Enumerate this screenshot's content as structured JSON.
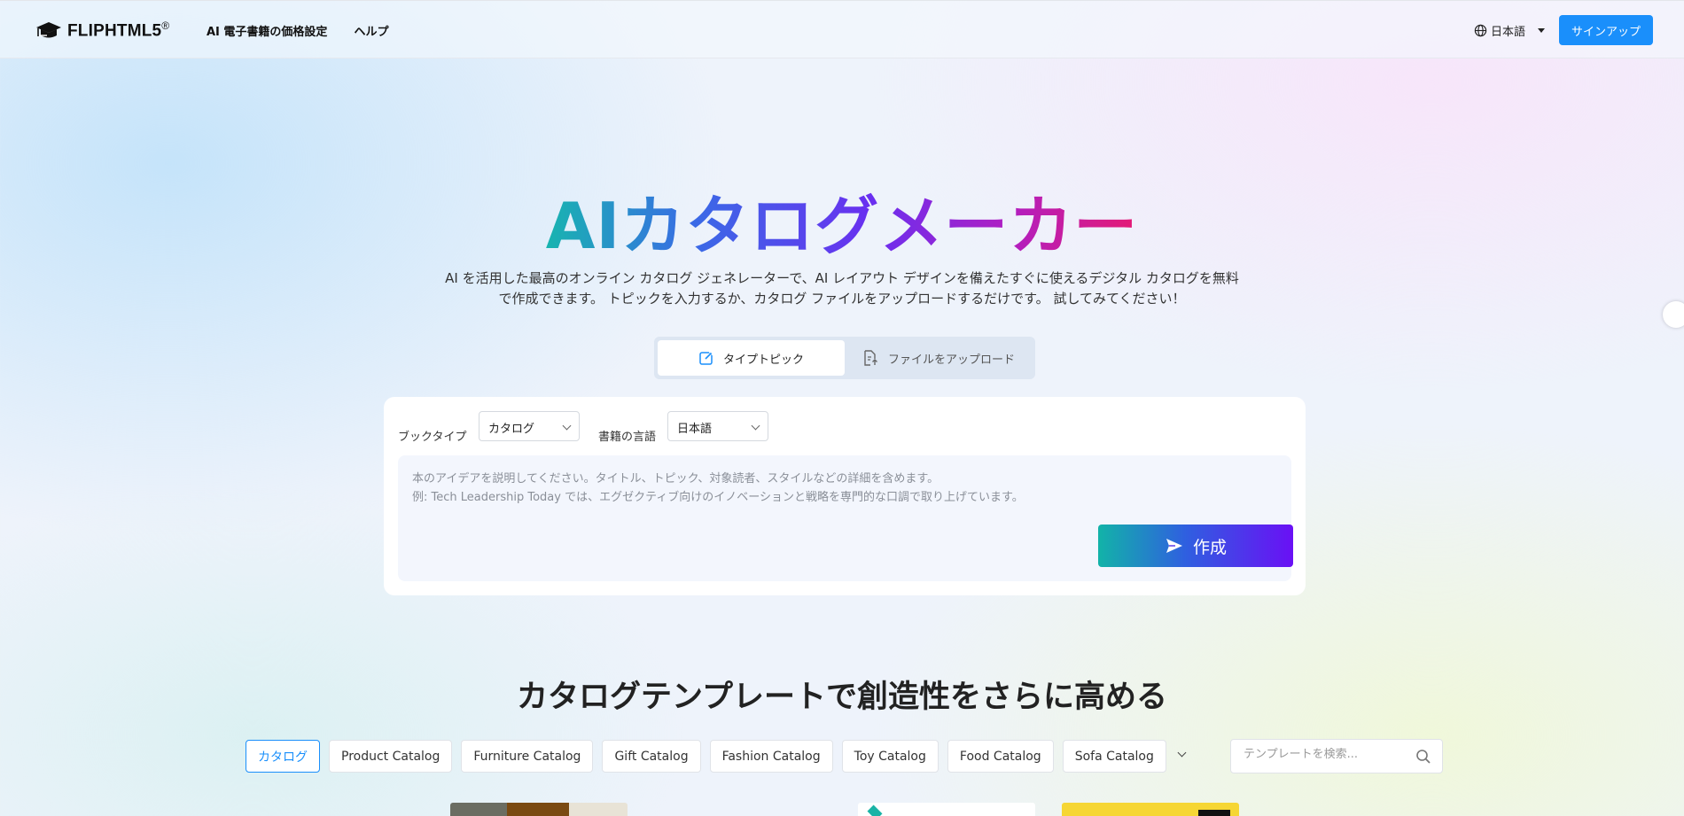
{
  "header": {
    "logo_text": "FLIPHTML5",
    "logo_mark": "®",
    "nav": [
      "AI 電子書籍の価格設定",
      "ヘルプ"
    ],
    "language": "日本語",
    "signup_label": "サインアップ"
  },
  "hero": {
    "title": "AIカタログメーカー",
    "description_line1": "AI を活用した最高のオンライン カタログ ジェネレーターで、AI レイアウト デザインを備えたすぐに使えるデジタル カタログを無料",
    "description_line2": "で作成できます。 トピックを入力するか、カタログ ファイルをアップロードするだけです。 試してみてください！"
  },
  "mode_tabs": [
    {
      "label": "タイプトピック",
      "icon": "edit-icon",
      "active": true
    },
    {
      "label": "ファイルをアップロード",
      "icon": "upload-file-icon",
      "active": false
    }
  ],
  "form": {
    "book_type_label": "ブックタイプ",
    "book_type_value": "カタログ",
    "language_label": "書籍の言語",
    "language_value": "日本語",
    "placeholder_line1": "本のアイデアを説明してください。タイトル、トピック、対象読者、スタイルなどの詳細を含めます。",
    "placeholder_line2": "例: Tech Leadership Today では、エグゼクティブ向けのイノベーションと戦略を専門的な口調で取り上げています。",
    "create_label": "作成"
  },
  "templates": {
    "title": "カタログテンプレートで創造性をさらに高める",
    "chips": [
      "カタログ",
      "Product Catalog",
      "Furniture Catalog",
      "Gift Catalog",
      "Fashion Catalog",
      "Toy Catalog",
      "Food Catalog",
      "Sofa Catalog"
    ],
    "active_chip": 0,
    "search_placeholder": "テンプレートを検索..."
  },
  "colors": {
    "accent": "#1a8ffb",
    "gradient_start": "#18b4b0",
    "gradient_end": "#e51a74"
  }
}
